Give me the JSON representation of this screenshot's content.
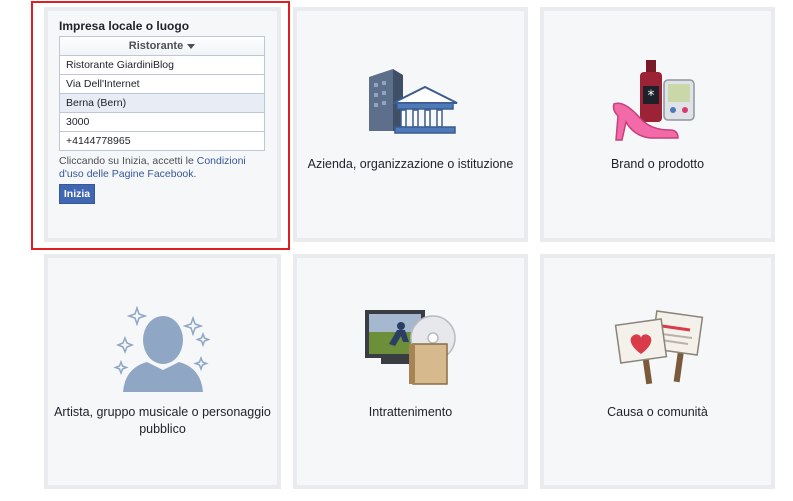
{
  "form_card": {
    "title": "Impresa locale o luogo",
    "category": "Ristorante",
    "fields": [
      {
        "value": "Ristorante GiardiniBlog"
      },
      {
        "value": "Via Dell'Internet"
      },
      {
        "value": "Berna (Bern)"
      },
      {
        "value": "3000"
      },
      {
        "value": "+4144778965"
      }
    ],
    "terms_prefix": "Cliccando su Inizia, accetti le ",
    "terms_link": "Condizioni d'uso delle Pagine Facebook",
    "terms_suffix": ".",
    "start_button": "Inizia"
  },
  "cards": [
    {
      "label": "Azienda, organizzazione o istituzione",
      "icon": "buildings-icon"
    },
    {
      "label": "Brand o prodotto",
      "icon": "products-icon"
    },
    {
      "label": "Artista, gruppo musicale o personaggio pubblico",
      "icon": "person-silhouette-icon"
    },
    {
      "label": "Intrattenimento",
      "icon": "media-icon"
    },
    {
      "label": "Causa o comunità",
      "icon": "signs-icon"
    }
  ],
  "colors": {
    "highlight": "#e01e22",
    "facebook_blue": "#4267b2",
    "card_bg": "#f6f7f9",
    "card_border": "#e9ebee"
  }
}
